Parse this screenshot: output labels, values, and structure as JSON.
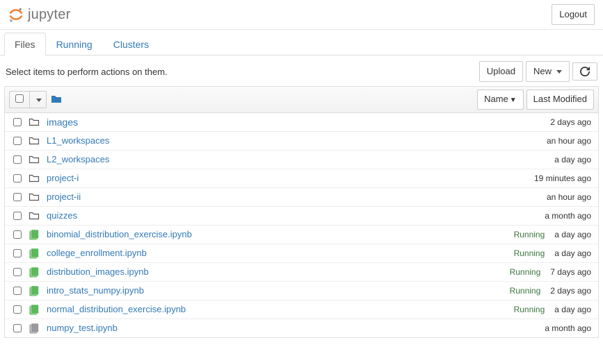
{
  "header": {
    "logo_text": "jupyter",
    "logout": "Logout"
  },
  "tabs": [
    {
      "label": "Files",
      "active": true
    },
    {
      "label": "Running",
      "active": false
    },
    {
      "label": "Clusters",
      "active": false
    }
  ],
  "action_hint": "Select items to perform actions on them.",
  "buttons": {
    "upload": "Upload",
    "new": "New"
  },
  "sort": {
    "name": "Name",
    "last_modified": "Last Modified"
  },
  "files": [
    {
      "name": "images",
      "type": "folder",
      "modified": "2 days ago",
      "status": ""
    },
    {
      "name": "L1_workspaces",
      "type": "folder",
      "modified": "an hour ago",
      "status": ""
    },
    {
      "name": "L2_workspaces",
      "type": "folder",
      "modified": "a day ago",
      "status": ""
    },
    {
      "name": "project-i",
      "type": "folder",
      "modified": "19 minutes ago",
      "status": ""
    },
    {
      "name": "project-ii",
      "type": "folder",
      "modified": "an hour ago",
      "status": ""
    },
    {
      "name": "quizzes",
      "type": "folder",
      "modified": "a month ago",
      "status": ""
    },
    {
      "name": "binomial_distribution_exercise.ipynb",
      "type": "running",
      "modified": "a day ago",
      "status": "Running"
    },
    {
      "name": "college_enrollment.ipynb",
      "type": "running",
      "modified": "a day ago",
      "status": "Running"
    },
    {
      "name": "distribution_images.ipynb",
      "type": "running",
      "modified": "7 days ago",
      "status": "Running"
    },
    {
      "name": "intro_stats_numpy.ipynb",
      "type": "running",
      "modified": "2 days ago",
      "status": "Running"
    },
    {
      "name": "normal_distribution_exercise.ipynb",
      "type": "running",
      "modified": "a day ago",
      "status": "Running"
    },
    {
      "name": "numpy_test.ipynb",
      "type": "notebook",
      "modified": "a month ago",
      "status": ""
    }
  ]
}
